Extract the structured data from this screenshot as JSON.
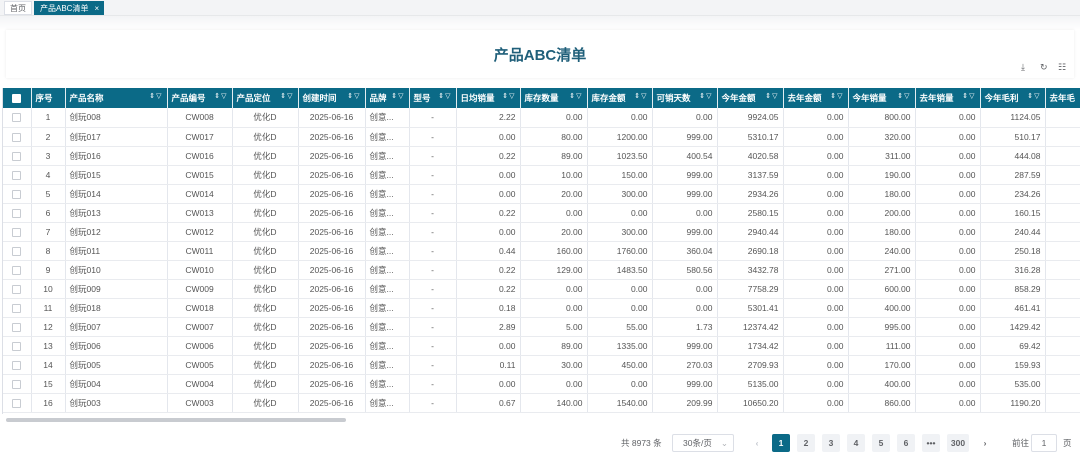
{
  "tabs": {
    "home": "首页",
    "active": "产品ABC清单",
    "close": "×"
  },
  "page_title": "产品ABC清单",
  "toolbar": {
    "download": "⤓",
    "refresh": "↻",
    "columns": "☷"
  },
  "header_icons": {
    "sort": "⇕",
    "filter": "▽"
  },
  "columns": [
    {
      "label": "",
      "sort": false,
      "filter": false
    },
    {
      "label": "序号",
      "sort": false,
      "filter": false
    },
    {
      "label": "产品名称",
      "sort": true,
      "filter": true
    },
    {
      "label": "产品编号",
      "sort": true,
      "filter": true
    },
    {
      "label": "产品定位",
      "sort": true,
      "filter": true
    },
    {
      "label": "创建时间",
      "sort": true,
      "filter": true
    },
    {
      "label": "品牌",
      "sort": true,
      "filter": true
    },
    {
      "label": "型号",
      "sort": true,
      "filter": true
    },
    {
      "label": "日均销量",
      "sort": true,
      "filter": true
    },
    {
      "label": "库存数量",
      "sort": true,
      "filter": true
    },
    {
      "label": "库存金额",
      "sort": true,
      "filter": true
    },
    {
      "label": "可销天数",
      "sort": true,
      "filter": true
    },
    {
      "label": "今年金额",
      "sort": true,
      "filter": true
    },
    {
      "label": "去年金额",
      "sort": true,
      "filter": true
    },
    {
      "label": "今年销量",
      "sort": true,
      "filter": true
    },
    {
      "label": "去年销量",
      "sort": true,
      "filter": true
    },
    {
      "label": "今年毛利",
      "sort": true,
      "filter": true
    },
    {
      "label": "去年毛",
      "sort": false,
      "filter": false
    }
  ],
  "rows": [
    [
      "1",
      "创玩008",
      "CW008",
      "优化D",
      "2025-06-16",
      "创意...",
      "-",
      "2.22",
      "0.00",
      "0.00",
      "0.00",
      "9924.05",
      "0.00",
      "800.00",
      "0.00",
      "1124.05"
    ],
    [
      "2",
      "创玩017",
      "CW017",
      "优化D",
      "2025-06-16",
      "创意...",
      "-",
      "0.00",
      "80.00",
      "1200.00",
      "999.00",
      "5310.17",
      "0.00",
      "320.00",
      "0.00",
      "510.17"
    ],
    [
      "3",
      "创玩016",
      "CW016",
      "优化D",
      "2025-06-16",
      "创意...",
      "-",
      "0.22",
      "89.00",
      "1023.50",
      "400.54",
      "4020.58",
      "0.00",
      "311.00",
      "0.00",
      "444.08"
    ],
    [
      "4",
      "创玩015",
      "CW015",
      "优化D",
      "2025-06-16",
      "创意...",
      "-",
      "0.00",
      "10.00",
      "150.00",
      "999.00",
      "3137.59",
      "0.00",
      "190.00",
      "0.00",
      "287.59"
    ],
    [
      "5",
      "创玩014",
      "CW014",
      "优化D",
      "2025-06-16",
      "创意...",
      "-",
      "0.00",
      "20.00",
      "300.00",
      "999.00",
      "2934.26",
      "0.00",
      "180.00",
      "0.00",
      "234.26"
    ],
    [
      "6",
      "创玩013",
      "CW013",
      "优化D",
      "2025-06-16",
      "创意...",
      "-",
      "0.22",
      "0.00",
      "0.00",
      "0.00",
      "2580.15",
      "0.00",
      "200.00",
      "0.00",
      "160.15"
    ],
    [
      "7",
      "创玩012",
      "CW012",
      "优化D",
      "2025-06-16",
      "创意...",
      "-",
      "0.00",
      "20.00",
      "300.00",
      "999.00",
      "2940.44",
      "0.00",
      "180.00",
      "0.00",
      "240.44"
    ],
    [
      "8",
      "创玩011",
      "CW011",
      "优化D",
      "2025-06-16",
      "创意...",
      "-",
      "0.44",
      "160.00",
      "1760.00",
      "360.04",
      "2690.18",
      "0.00",
      "240.00",
      "0.00",
      "250.18"
    ],
    [
      "9",
      "创玩010",
      "CW010",
      "优化D",
      "2025-06-16",
      "创意...",
      "-",
      "0.22",
      "129.00",
      "1483.50",
      "580.56",
      "3432.78",
      "0.00",
      "271.00",
      "0.00",
      "316.28"
    ],
    [
      "10",
      "创玩009",
      "CW009",
      "优化D",
      "2025-06-16",
      "创意...",
      "-",
      "0.22",
      "0.00",
      "0.00",
      "0.00",
      "7758.29",
      "0.00",
      "600.00",
      "0.00",
      "858.29"
    ],
    [
      "11",
      "创玩018",
      "CW018",
      "优化D",
      "2025-06-16",
      "创意...",
      "-",
      "0.18",
      "0.00",
      "0.00",
      "0.00",
      "5301.41",
      "0.00",
      "400.00",
      "0.00",
      "461.41"
    ],
    [
      "12",
      "创玩007",
      "CW007",
      "优化D",
      "2025-06-16",
      "创意...",
      "-",
      "2.89",
      "5.00",
      "55.00",
      "1.73",
      "12374.42",
      "0.00",
      "995.00",
      "0.00",
      "1429.42"
    ],
    [
      "13",
      "创玩006",
      "CW006",
      "优化D",
      "2025-06-16",
      "创意...",
      "-",
      "0.00",
      "89.00",
      "1335.00",
      "999.00",
      "1734.42",
      "0.00",
      "111.00",
      "0.00",
      "69.42"
    ],
    [
      "14",
      "创玩005",
      "CW005",
      "优化D",
      "2025-06-16",
      "创意...",
      "-",
      "0.11",
      "30.00",
      "450.00",
      "270.03",
      "2709.93",
      "0.00",
      "170.00",
      "0.00",
      "159.93"
    ],
    [
      "15",
      "创玩004",
      "CW004",
      "优化D",
      "2025-06-16",
      "创意...",
      "-",
      "0.00",
      "0.00",
      "0.00",
      "999.00",
      "5135.00",
      "0.00",
      "400.00",
      "0.00",
      "535.00"
    ],
    [
      "16",
      "创玩003",
      "CW003",
      "优化D",
      "2025-06-16",
      "创意...",
      "-",
      "0.67",
      "140.00",
      "1540.00",
      "209.99",
      "10650.20",
      "0.00",
      "860.00",
      "0.00",
      "1190.20"
    ]
  ],
  "pager": {
    "total": "共 8973 条",
    "page_size": "30条/页",
    "dropdown_arrow": "⌄",
    "prev": "‹",
    "next": "›",
    "pages": [
      "1",
      "2",
      "3",
      "4",
      "5",
      "6",
      "•••",
      "300"
    ],
    "current": "1",
    "goto_prefix": "前往",
    "goto_value": "1",
    "goto_suffix": "页"
  },
  "colors": {
    "header_bg": "#0b6a87",
    "title": "#1f5f7a",
    "active_page": "#0b6a87"
  }
}
